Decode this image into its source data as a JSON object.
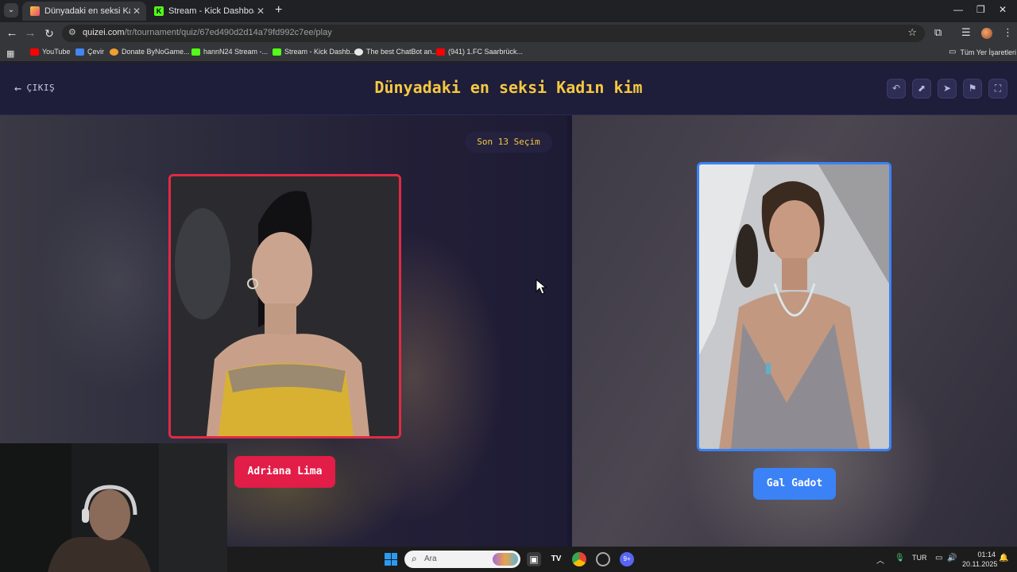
{
  "browser": {
    "tabs": [
      {
        "title": "Dünyadaki en seksi Kadın kim - ",
        "active": true
      },
      {
        "title": "Stream - Kick Dashboard",
        "active": false
      }
    ],
    "url_host": "quizei.com",
    "url_path": "/tr/tournament/quiz/67ed490d2d14a79fd992c7ee/play",
    "bookmarks": [
      "YouTube",
      "Çevir",
      "Donate ByNoGame...",
      "hannN24 Stream -...",
      "Stream - Kick Dashb...",
      "The best ChatBot an...",
      "(941) 1.FC Saarbrück..."
    ],
    "all_bookmarks_label": "Tüm Yer İşaretleri"
  },
  "page": {
    "exit_label": "ÇIKIŞ",
    "title": "Dünyadaki en seksi Kadın kim",
    "recent_label": "Son 13 Seçim",
    "left_choice": {
      "name": "Adriana Lima",
      "accent": "#e11d48"
    },
    "right_choice": {
      "name": "Gal Gadot",
      "accent": "#3b82f6"
    },
    "header_icons": [
      "undo-icon",
      "share-icon",
      "send-icon",
      "flag-icon",
      "fullscreen-icon"
    ],
    "title_color": "#f5c842"
  },
  "taskbar": {
    "search_placeholder": "Ara",
    "language": "TUR",
    "time": "01:14",
    "date": "20.11.2025",
    "discord_badge": "9+"
  }
}
